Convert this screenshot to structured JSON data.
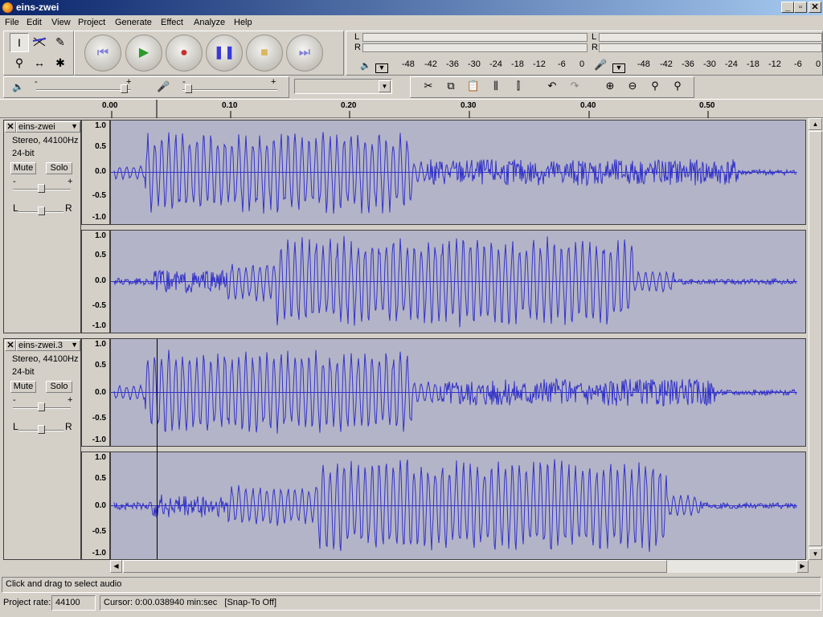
{
  "window": {
    "title": "eins-zwei"
  },
  "menu": [
    "File",
    "Edit",
    "View",
    "Project",
    "Generate",
    "Effect",
    "Analyze",
    "Help"
  ],
  "meters": {
    "play_ticks": [
      "-48",
      "-42",
      "-36",
      "-30",
      "-24",
      "-18",
      "-12",
      "-6",
      "0"
    ],
    "rec_ticks": [
      "-48",
      "-42",
      "-36",
      "-30",
      "-24",
      "-18",
      "-12",
      "-6",
      "0"
    ],
    "lr": [
      "L",
      "R"
    ]
  },
  "mixer": {
    "minus": "-",
    "plus": "+"
  },
  "ruler": {
    "ticks": [
      "0.00",
      "0.10",
      "0.20",
      "0.30",
      "0.40",
      "0.50"
    ]
  },
  "tracks": [
    {
      "name": "eins-zwei",
      "format": "Stereo, 44100Hz",
      "bits": "24-bit",
      "mute": "Mute",
      "solo": "Solo",
      "pan_left": "L",
      "pan_right": "R",
      "gain_minus": "-",
      "gain_plus": "+",
      "scale": [
        "1.0",
        "0.5",
        "0.0",
        "-0.5",
        "-1.0"
      ]
    },
    {
      "name": "eins-zwei.3",
      "format": "Stereo, 44100Hz",
      "bits": "24-bit",
      "mute": "Mute",
      "solo": "Solo",
      "pan_left": "L",
      "pan_right": "R",
      "gain_minus": "-",
      "gain_plus": "+",
      "scale": [
        "1.0",
        "0.5",
        "0.0",
        "-0.5",
        "-1.0"
      ]
    }
  ],
  "status": {
    "hint": "Click and drag to select audio",
    "rate_label": "Project rate:",
    "rate_value": "44100",
    "cursor": "Cursor: 0:00.038940 min:sec   [Snap-To Off]"
  },
  "colors": {
    "waveform": "#3232c8",
    "track_bg": "#b4b4c8"
  },
  "icons": {
    "close": "close-icon",
    "dropdown": "dropdown-arrow-icon"
  }
}
